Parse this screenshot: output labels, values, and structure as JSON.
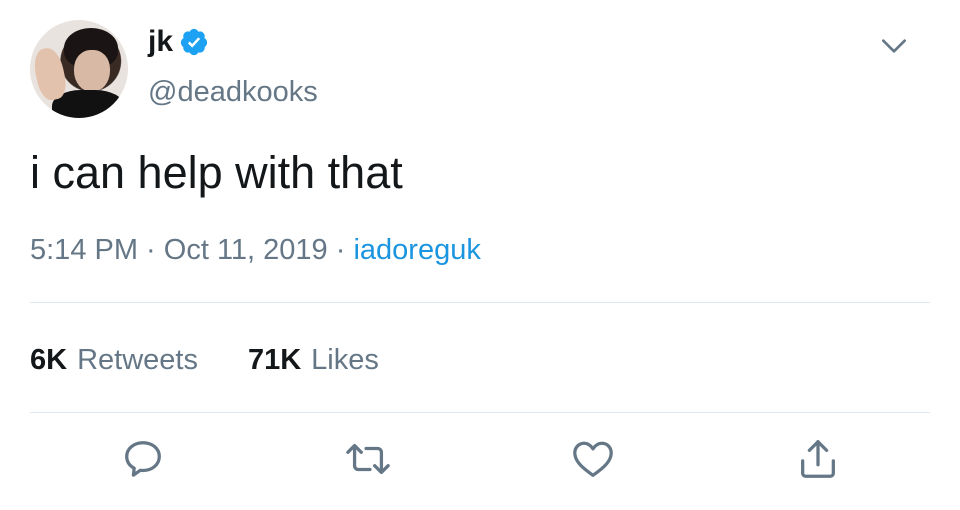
{
  "user": {
    "name": "jk",
    "handle": "@deadkooks",
    "verified_color": "#1da1f2"
  },
  "tweet": {
    "text": "i can help with that",
    "time": "5:14 PM",
    "date": "Oct 11, 2019",
    "source": "iadoreguk",
    "separator": " · "
  },
  "stats": {
    "retweets_count": "6K",
    "retweets_label": "Retweets",
    "likes_count": "71K",
    "likes_label": "Likes"
  },
  "icons": {
    "menu": "chevron-down-icon",
    "reply": "reply-icon",
    "retweet": "retweet-icon",
    "like": "heart-icon",
    "share": "share-icon"
  },
  "colors": {
    "text": "#14171a",
    "muted": "#657786",
    "link": "#1b95e0",
    "divider": "#e1e8ed"
  }
}
